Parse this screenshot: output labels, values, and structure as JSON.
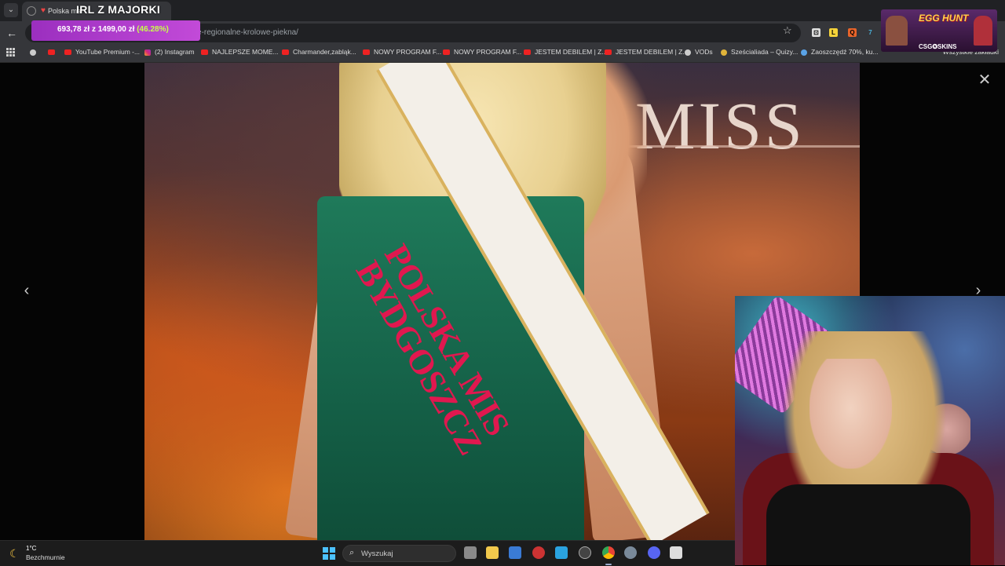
{
  "browser": {
    "tab_title": "Polska ma",
    "stream_title": "IRL Z MAJORKI",
    "url": "woje-regionalne-krolowe-piekna/",
    "donation": {
      "current": "693,78 zł",
      "separator": "z",
      "goal": "1499,00 zł",
      "percent": "(46.28%)"
    }
  },
  "bookmarks": [
    {
      "label": "YouTube Premium -...",
      "icon": "youtube-icon"
    },
    {
      "label": "(2) Instagram",
      "icon": "instagram-icon"
    },
    {
      "label": "NAJLEPSZE MOME...",
      "icon": "youtube-icon"
    },
    {
      "label": "Charmander,zabląk...",
      "icon": "youtube-icon"
    },
    {
      "label": "NOWY PROGRAM F...",
      "icon": "youtube-icon"
    },
    {
      "label": "NOWY PROGRAM F...",
      "icon": "youtube-icon"
    },
    {
      "label": "JESTEM DEBILEM | Z...",
      "icon": "youtube-icon"
    },
    {
      "label": "JESTEM DEBILEM | Z...",
      "icon": "youtube-icon"
    },
    {
      "label": "VODs",
      "icon": "globe-icon"
    },
    {
      "label": "Sześcialiada – Quizy...",
      "icon": "award-icon"
    },
    {
      "label": "Zaoszczędź 70%, ku...",
      "icon": "steam-icon"
    }
  ],
  "bookmarks_all": "Wszystkie zakładki",
  "gallery": {
    "photo_text_miss": "MISS",
    "sash_line1": "POLSKA MIS",
    "sash_line2": "BYDGOSZCZ"
  },
  "overlay": {
    "egg_title": "EGG HUNT",
    "sponsor": "CSG✪SKINS"
  },
  "taskbar": {
    "temperature": "1°C",
    "weather": "Bezchmurnie",
    "search_placeholder": "Wyszukaj"
  },
  "colors": {
    "donation_accent": "#c24ad8",
    "percent_color": "#c6ff4a",
    "sash_text": "#e0184f",
    "dress": "#1f7a5a"
  }
}
